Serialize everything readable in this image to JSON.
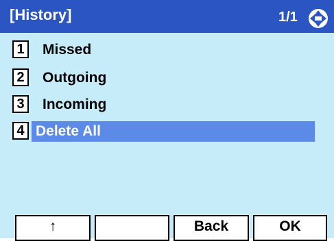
{
  "header": {
    "title": "[History]",
    "page": "1/1",
    "nav_icon": "up-down-navigation-icon"
  },
  "menu": {
    "items": [
      {
        "number": "1",
        "label": "Missed"
      },
      {
        "number": "2",
        "label": "Outgoing"
      },
      {
        "number": "3",
        "label": "Incoming"
      },
      {
        "number": "4",
        "label": "Delete All",
        "selected": true
      }
    ]
  },
  "softkeys": {
    "key1": "↑",
    "key2": "",
    "key3": "Back",
    "key4": "OK"
  },
  "colors": {
    "header_bg": "#2a55c2",
    "screen_bg": "#c6ecfa",
    "selection_bg": "#5b8be7"
  }
}
